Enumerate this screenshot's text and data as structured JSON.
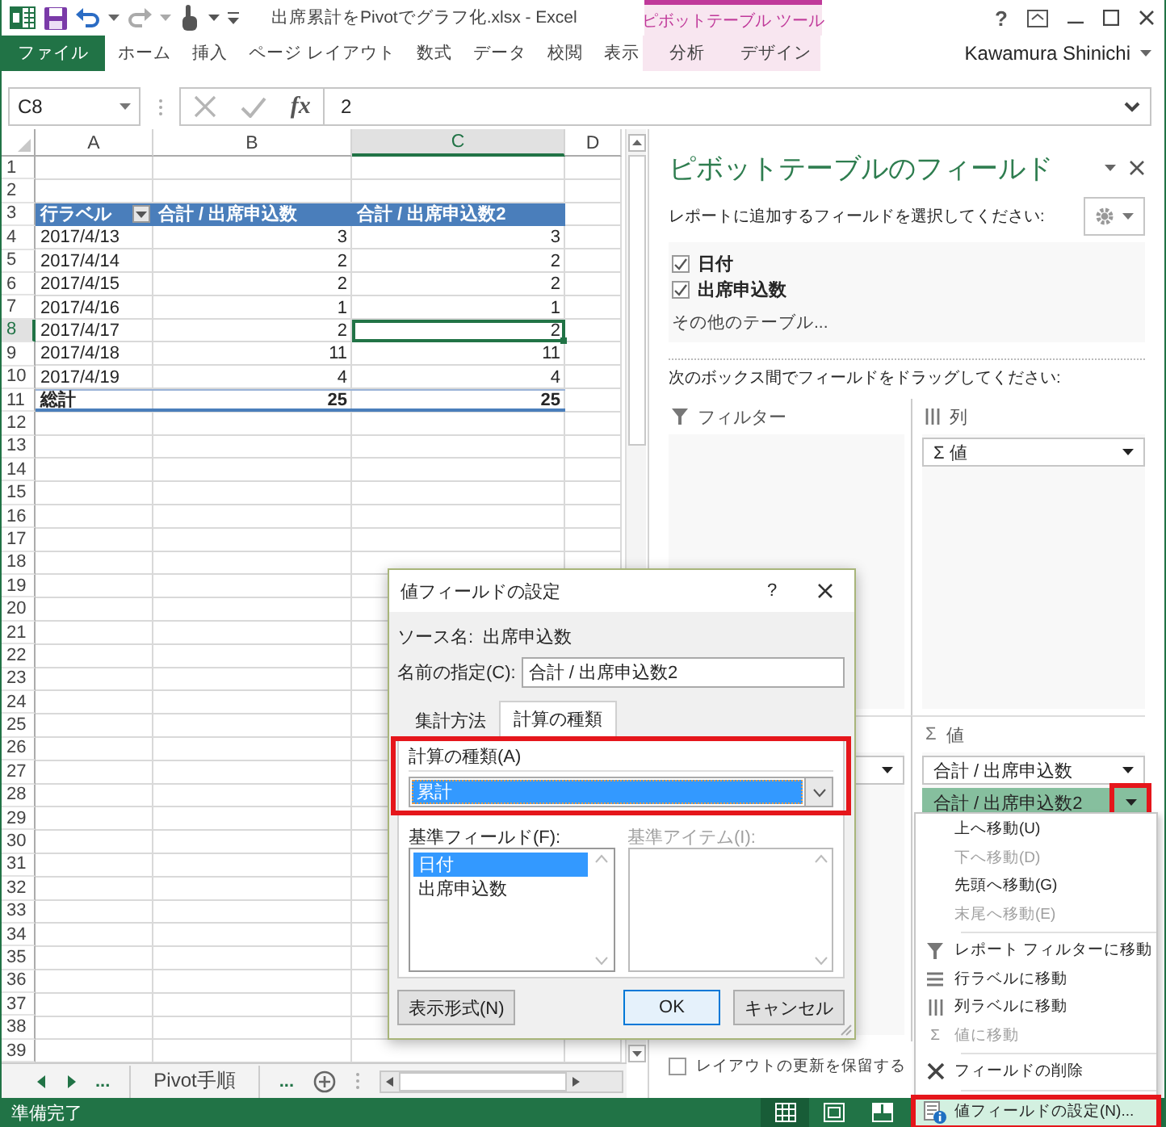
{
  "window": {
    "title": "出席累計をPivotでグラフ化.xlsx - Excel",
    "context_group": "ピボットテーブル ツール",
    "help": "?",
    "user": "Kawamura Shinichi"
  },
  "ribbon_tabs": [
    {
      "label": "ファイル",
      "kind": "file"
    },
    {
      "label": "ホーム",
      "kind": "normal"
    },
    {
      "label": "挿入",
      "kind": "normal"
    },
    {
      "label": "ページ レイアウト",
      "kind": "normal"
    },
    {
      "label": "数式",
      "kind": "normal"
    },
    {
      "label": "データ",
      "kind": "normal"
    },
    {
      "label": "校閲",
      "kind": "normal"
    },
    {
      "label": "表示",
      "kind": "normal"
    },
    {
      "label": "分析",
      "kind": "context"
    },
    {
      "label": "デザイン",
      "kind": "context"
    }
  ],
  "formula_bar": {
    "name_box": "C8",
    "function_label": "fx",
    "value": "2"
  },
  "sheet": {
    "columns": [
      {
        "label": "A",
        "selected": false
      },
      {
        "label": "B",
        "selected": false
      },
      {
        "label": "C",
        "selected": true
      },
      {
        "label": "D",
        "selected": false
      }
    ],
    "rows": [
      {
        "number": "1",
        "selected": false
      },
      {
        "number": "2",
        "selected": false
      },
      {
        "number": "3",
        "selected": false,
        "cells": [
          {
            "text": "行ラベル",
            "kind": "header-filter",
            "selected": false
          },
          {
            "text": "合計 / 出席申込数",
            "kind": "header",
            "selected": false
          },
          {
            "text": "合計 / 出席申込数2",
            "kind": "header",
            "selected": false
          }
        ]
      },
      {
        "number": "4",
        "selected": false,
        "cells": [
          {
            "text": "2017/4/13",
            "kind": "label",
            "selected": false
          },
          {
            "text": "3",
            "kind": "number",
            "selected": false
          },
          {
            "text": "3",
            "kind": "number",
            "selected": false
          }
        ]
      },
      {
        "number": "5",
        "selected": false,
        "cells": [
          {
            "text": "2017/4/14",
            "kind": "label",
            "selected": false
          },
          {
            "text": "2",
            "kind": "number",
            "selected": false
          },
          {
            "text": "2",
            "kind": "number",
            "selected": false
          }
        ]
      },
      {
        "number": "6",
        "selected": false,
        "cells": [
          {
            "text": "2017/4/15",
            "kind": "label",
            "selected": false
          },
          {
            "text": "2",
            "kind": "number",
            "selected": false
          },
          {
            "text": "2",
            "kind": "number",
            "selected": false
          }
        ]
      },
      {
        "number": "7",
        "selected": false,
        "cells": [
          {
            "text": "2017/4/16",
            "kind": "label",
            "selected": false
          },
          {
            "text": "1",
            "kind": "number",
            "selected": false
          },
          {
            "text": "1",
            "kind": "number",
            "selected": false
          }
        ]
      },
      {
        "number": "8",
        "selected": true,
        "cells": [
          {
            "text": "2017/4/17",
            "kind": "label",
            "selected": false
          },
          {
            "text": "2",
            "kind": "number",
            "selected": false
          },
          {
            "text": "2",
            "kind": "number",
            "selected": true
          }
        ]
      },
      {
        "number": "9",
        "selected": false,
        "cells": [
          {
            "text": "2017/4/18",
            "kind": "label",
            "selected": false
          },
          {
            "text": "11",
            "kind": "number",
            "selected": false
          },
          {
            "text": "11",
            "kind": "number",
            "selected": false
          }
        ]
      },
      {
        "number": "10",
        "selected": false,
        "cells": [
          {
            "text": "2017/4/19",
            "kind": "label",
            "selected": false
          },
          {
            "text": "4",
            "kind": "number",
            "selected": false
          },
          {
            "text": "4",
            "kind": "number",
            "selected": false
          }
        ]
      },
      {
        "number": "11",
        "selected": false,
        "cells": [
          {
            "text": "総計",
            "kind": "total-label",
            "selected": false
          },
          {
            "text": "25",
            "kind": "total-number",
            "selected": false
          },
          {
            "text": "25",
            "kind": "total-number",
            "selected": false
          }
        ]
      },
      {
        "number": "12",
        "selected": false
      },
      {
        "number": "13",
        "selected": false
      },
      {
        "number": "14",
        "selected": false
      },
      {
        "number": "15",
        "selected": false
      },
      {
        "number": "16",
        "selected": false
      },
      {
        "number": "17",
        "selected": false
      },
      {
        "number": "18",
        "selected": false
      },
      {
        "number": "19",
        "selected": false
      },
      {
        "number": "20",
        "selected": false
      },
      {
        "number": "21",
        "selected": false
      },
      {
        "number": "22",
        "selected": false
      },
      {
        "number": "23",
        "selected": false
      },
      {
        "number": "24",
        "selected": false
      },
      {
        "number": "25",
        "selected": false
      },
      {
        "number": "26",
        "selected": false
      },
      {
        "number": "27",
        "selected": false
      },
      {
        "number": "28",
        "selected": false
      },
      {
        "number": "29",
        "selected": false
      },
      {
        "number": "30",
        "selected": false
      },
      {
        "number": "31",
        "selected": false
      },
      {
        "number": "32",
        "selected": false
      },
      {
        "number": "33",
        "selected": false
      },
      {
        "number": "34",
        "selected": false
      },
      {
        "number": "35",
        "selected": false
      },
      {
        "number": "36",
        "selected": false
      },
      {
        "number": "37",
        "selected": false
      },
      {
        "number": "38",
        "selected": false
      },
      {
        "number": "39",
        "selected": false
      }
    ]
  },
  "sheet_tabs": [
    {
      "label": "...",
      "kind": "more",
      "selected": false
    },
    {
      "label": "Pivot手順",
      "kind": "sheet",
      "selected": false
    },
    {
      "label": "...",
      "kind": "more",
      "selected": false
    }
  ],
  "status_bar": {
    "text": "準備完了",
    "views": [
      {
        "kind": "normal",
        "selected": true
      },
      {
        "kind": "page-layout",
        "selected": false
      },
      {
        "kind": "page-break",
        "selected": false
      }
    ]
  },
  "field_pane": {
    "title": "ピボットテーブルのフィールド",
    "subtitle": "レポートに追加するフィールドを選択してください:",
    "fields": [
      {
        "label": "日付",
        "checked": true
      },
      {
        "label": "出席申込数",
        "checked": true
      }
    ],
    "more_tables": "その他のテーブル...",
    "areas_hint": "次のボックス間でフィールドをドラッグしてください:",
    "areas": [
      {
        "kind": "filters",
        "label": "フィルター"
      },
      {
        "kind": "columns",
        "label": "列",
        "items": [
          {
            "label": "Σ 値",
            "selected": false,
            "arrow_highlighted": false
          }
        ]
      },
      {
        "kind": "rows",
        "items": [
          {
            "selected": false,
            "arrow_highlighted": false
          }
        ]
      },
      {
        "kind": "values",
        "symbol": "Σ",
        "label": "値",
        "items": [
          {
            "label": "合計 / 出席申込数",
            "selected": false,
            "arrow_highlighted": false
          },
          {
            "label": "合計 / 出席申込数2",
            "selected": true,
            "arrow_highlighted": true
          }
        ]
      }
    ],
    "defer_update": {
      "label": "レイアウトの更新を保留する",
      "checked": false
    }
  },
  "dialog": {
    "title": "値フィールドの設定",
    "help": "?",
    "source_label": "ソース名:",
    "source_value": "出席申込数",
    "name_label": "名前の指定(C):",
    "name_value": "合計 / 出席申込数2",
    "tabs": [
      {
        "label": "集計方法",
        "selected": false
      },
      {
        "label": "計算の種類",
        "selected": true
      }
    ],
    "calc_label": "計算の種類(A)",
    "calc_value": "累計",
    "calc_highlighted": true,
    "base_field_label": "基準フィールド(F):",
    "base_fields": [
      {
        "label": "日付",
        "selected": true
      },
      {
        "label": "出席申込数",
        "selected": false
      }
    ],
    "base_item_label": "基準アイテム(I):",
    "base_item_disabled": true,
    "buttons": [
      {
        "label": "表示形式(N)",
        "kind": "secondary"
      },
      {
        "label": "OK",
        "kind": "default"
      },
      {
        "label": "キャンセル",
        "kind": "secondary"
      }
    ]
  },
  "context_menu": [
    {
      "kind": "plain",
      "label": "上へ移動(U)",
      "disabled": false,
      "selected": false,
      "highlighted": false
    },
    {
      "kind": "plain",
      "label": "下へ移動(D)",
      "disabled": true,
      "selected": false,
      "highlighted": false
    },
    {
      "kind": "plain",
      "label": "先頭へ移動(G)",
      "disabled": false,
      "selected": false,
      "highlighted": false
    },
    {
      "kind": "plain",
      "label": "末尾へ移動(E)",
      "disabled": true,
      "selected": false,
      "highlighted": false
    },
    {
      "kind": "separator"
    },
    {
      "kind": "filter",
      "label": "レポート フィルターに移動",
      "disabled": false,
      "selected": false,
      "highlighted": false
    },
    {
      "kind": "rows",
      "label": "行ラベルに移動",
      "disabled": false,
      "selected": false,
      "highlighted": false
    },
    {
      "kind": "columns",
      "label": "列ラベルに移動",
      "disabled": false,
      "selected": false,
      "highlighted": false
    },
    {
      "kind": "values",
      "symbol": "Σ",
      "label": "値に移動",
      "disabled": true,
      "selected": false,
      "highlighted": false
    },
    {
      "kind": "separator"
    },
    {
      "kind": "remove",
      "label": "フィールドの削除",
      "disabled": false,
      "selected": false,
      "highlighted": false
    },
    {
      "kind": "separator"
    },
    {
      "kind": "settings",
      "label": "値フィールドの設定(N)...",
      "disabled": false,
      "selected": true,
      "highlighted": true
    }
  ]
}
